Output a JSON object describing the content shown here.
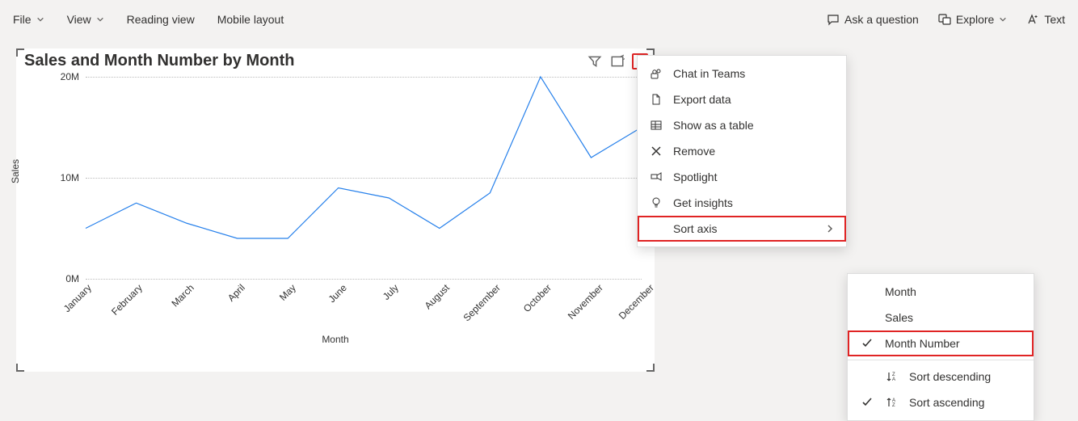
{
  "toolbar": {
    "file": "File",
    "view": "View",
    "reading_view": "Reading view",
    "mobile_layout": "Mobile layout",
    "ask": "Ask a question",
    "explore": "Explore",
    "text": "Text"
  },
  "visual": {
    "title": "Sales and Month Number by Month",
    "y_label": "Sales",
    "x_label": "Month",
    "y_ticks": [
      "0M",
      "10M",
      "20M"
    ]
  },
  "menu1": {
    "chat": "Chat in Teams",
    "export": "Export data",
    "show_table": "Show as a table",
    "remove": "Remove",
    "spotlight": "Spotlight",
    "insights": "Get insights",
    "sort_axis": "Sort axis"
  },
  "menu2": {
    "month": "Month",
    "sales": "Sales",
    "month_number": "Month Number",
    "sort_desc": "Sort descending",
    "sort_asc": "Sort ascending"
  },
  "chart_data": {
    "type": "line",
    "title": "Sales and Month Number by Month",
    "xlabel": "Month",
    "ylabel": "Sales",
    "ylim": [
      0,
      20000000
    ],
    "y_tick_values": [
      0,
      10000000,
      20000000
    ],
    "categories": [
      "January",
      "February",
      "March",
      "April",
      "May",
      "June",
      "July",
      "August",
      "September",
      "October",
      "November",
      "December"
    ],
    "series": [
      {
        "name": "Sales",
        "values": [
          5000000,
          7500000,
          5500000,
          4000000,
          4000000,
          9000000,
          8000000,
          5000000,
          8500000,
          20000000,
          12000000,
          15000000
        ]
      }
    ]
  }
}
